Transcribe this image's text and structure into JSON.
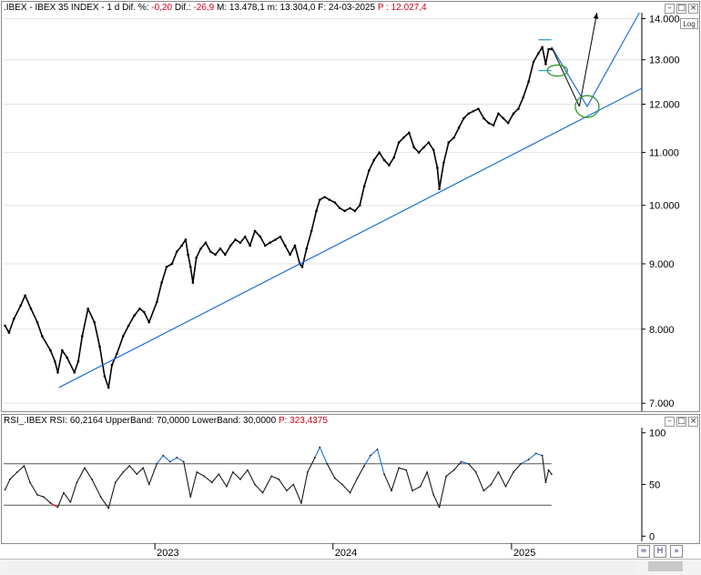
{
  "price_header": {
    "symbol": ".IBEX - IBEX 35 INDEX - 1 d",
    "dif_label": "Dif. %:",
    "dif_pct": "-0,20",
    "dif_abs_label": "Dif.:",
    "dif_abs": "-26,9",
    "max_label": "M:",
    "max": "13.478,1",
    "min_label": "m:",
    "min": "13.304,0",
    "date_label": "F:",
    "date": "24-03-2025",
    "p_label": "P :",
    "p_value": "12.027,4"
  },
  "rsi_header": {
    "name": "RSI_.IBEX",
    "rsi_label": "RSI:",
    "rsi_value": "60,2164",
    "upper_label": "UpperBand:",
    "upper_value": "70,0000",
    "lower_label": "LowerBand:",
    "lower_value": "30,0000",
    "p_label": "P:",
    "p_value": "323,4375"
  },
  "controls": {
    "log_label": "Log",
    "minimize_glyph": "–",
    "maximize_glyph": "□",
    "close_glyph": "×"
  },
  "colors": {
    "price": "#000000",
    "trendline": "#1f6fd6",
    "ellipse": "#2e9a2e",
    "rsi_line": "#1a1a1a",
    "rsi_over": "#1f6fd6",
    "rsi_under": "#d0021b",
    "band": "#555555",
    "grid": "#e3e3e3"
  },
  "chart_data": [
    {
      "type": "line",
      "title": "",
      "scale": "log",
      "ylim": [
        6900,
        14150
      ],
      "y_ticks": [
        {
          "value": 7000,
          "label": "7.000"
        },
        {
          "value": 8000,
          "label": "8.000"
        },
        {
          "value": 9000,
          "label": "9.000"
        },
        {
          "value": 10000,
          "label": "10.000"
        },
        {
          "value": 11000,
          "label": "11.000"
        },
        {
          "value": 12000,
          "label": "12.000"
        },
        {
          "value": 13000,
          "label": "13.000"
        },
        {
          "value": 14000,
          "label": "14.000"
        }
      ],
      "x_range": [
        "2022-02-25",
        "2025-09-25"
      ],
      "x_ticks": [
        {
          "date": "2023-01-01",
          "label": "2023"
        },
        {
          "date": "2024-01-01",
          "label": "2024"
        },
        {
          "date": "2025-01-01",
          "label": "2025"
        }
      ],
      "series": [
        {
          "key": "close",
          "points": [
            [
              "2022-02-28",
              8050
            ],
            [
              "2022-03-08",
              7950
            ],
            [
              "2022-03-18",
              8150
            ],
            [
              "2022-04-01",
              8350
            ],
            [
              "2022-04-10",
              8500
            ],
            [
              "2022-04-22",
              8300
            ],
            [
              "2022-05-05",
              8100
            ],
            [
              "2022-05-15",
              7900
            ],
            [
              "2022-06-01",
              7700
            ],
            [
              "2022-06-10",
              7550
            ],
            [
              "2022-06-16",
              7400
            ],
            [
              "2022-06-25",
              7700
            ],
            [
              "2022-07-05",
              7600
            ],
            [
              "2022-07-20",
              7400
            ],
            [
              "2022-07-28",
              7550
            ],
            [
              "2022-08-05",
              7900
            ],
            [
              "2022-08-17",
              8300
            ],
            [
              "2022-08-30",
              8100
            ],
            [
              "2022-09-10",
              7750
            ],
            [
              "2022-09-20",
              7350
            ],
            [
              "2022-09-28",
              7200
            ],
            [
              "2022-10-05",
              7500
            ],
            [
              "2022-10-15",
              7650
            ],
            [
              "2022-10-28",
              7900
            ],
            [
              "2022-11-08",
              8050
            ],
            [
              "2022-11-20",
              8200
            ],
            [
              "2022-12-01",
              8300
            ],
            [
              "2022-12-10",
              8250
            ],
            [
              "2022-12-20",
              8100
            ],
            [
              "2023-01-05",
              8400
            ],
            [
              "2023-01-15",
              8700
            ],
            [
              "2023-01-25",
              8950
            ],
            [
              "2023-02-05",
              9000
            ],
            [
              "2023-02-15",
              9200
            ],
            [
              "2023-02-25",
              9300
            ],
            [
              "2023-03-05",
              9400
            ],
            [
              "2023-03-10",
              9150
            ],
            [
              "2023-03-15",
              8950
            ],
            [
              "2023-03-20",
              8700
            ],
            [
              "2023-03-27",
              9100
            ],
            [
              "2023-04-05",
              9250
            ],
            [
              "2023-04-15",
              9350
            ],
            [
              "2023-04-25",
              9200
            ],
            [
              "2023-05-05",
              9150
            ],
            [
              "2023-05-15",
              9250
            ],
            [
              "2023-05-25",
              9150
            ],
            [
              "2023-06-05",
              9300
            ],
            [
              "2023-06-15",
              9400
            ],
            [
              "2023-06-25",
              9350
            ],
            [
              "2023-07-05",
              9450
            ],
            [
              "2023-07-15",
              9300
            ],
            [
              "2023-07-25",
              9550
            ],
            [
              "2023-08-05",
              9450
            ],
            [
              "2023-08-15",
              9300
            ],
            [
              "2023-08-25",
              9350
            ],
            [
              "2023-09-05",
              9400
            ],
            [
              "2023-09-15",
              9450
            ],
            [
              "2023-09-25",
              9300
            ],
            [
              "2023-10-05",
              9150
            ],
            [
              "2023-10-15",
              9300
            ],
            [
              "2023-10-25",
              9000
            ],
            [
              "2023-10-30",
              8950
            ],
            [
              "2023-11-08",
              9250
            ],
            [
              "2023-11-18",
              9550
            ],
            [
              "2023-11-28",
              9900
            ],
            [
              "2023-12-05",
              10100
            ],
            [
              "2023-12-15",
              10150
            ],
            [
              "2023-12-25",
              10100
            ],
            [
              "2024-01-05",
              10050
            ],
            [
              "2024-01-15",
              9950
            ],
            [
              "2024-01-25",
              9900
            ],
            [
              "2024-02-05",
              9950
            ],
            [
              "2024-02-15",
              9900
            ],
            [
              "2024-02-25",
              10000
            ],
            [
              "2024-03-05",
              10350
            ],
            [
              "2024-03-15",
              10650
            ],
            [
              "2024-03-25",
              10850
            ],
            [
              "2024-04-05",
              11000
            ],
            [
              "2024-04-15",
              10850
            ],
            [
              "2024-04-25",
              10750
            ],
            [
              "2024-05-05",
              10900
            ],
            [
              "2024-05-15",
              11200
            ],
            [
              "2024-05-25",
              11300
            ],
            [
              "2024-06-05",
              11400
            ],
            [
              "2024-06-15",
              11100
            ],
            [
              "2024-06-25",
              11000
            ],
            [
              "2024-07-05",
              11100
            ],
            [
              "2024-07-15",
              11200
            ],
            [
              "2024-07-25",
              11050
            ],
            [
              "2024-08-02",
              10700
            ],
            [
              "2024-08-06",
              10300
            ],
            [
              "2024-08-15",
              10800
            ],
            [
              "2024-08-25",
              11200
            ],
            [
              "2024-09-05",
              11300
            ],
            [
              "2024-09-15",
              11500
            ],
            [
              "2024-09-25",
              11700
            ],
            [
              "2024-10-05",
              11800
            ],
            [
              "2024-10-15",
              11850
            ],
            [
              "2024-10-25",
              11900
            ],
            [
              "2024-11-05",
              11700
            ],
            [
              "2024-11-15",
              11600
            ],
            [
              "2024-11-25",
              11550
            ],
            [
              "2024-12-05",
              11800
            ],
            [
              "2024-12-15",
              11700
            ],
            [
              "2024-12-25",
              11600
            ],
            [
              "2025-01-05",
              11800
            ],
            [
              "2025-01-15",
              11900
            ],
            [
              "2025-01-25",
              12150
            ],
            [
              "2025-02-05",
              12500
            ],
            [
              "2025-02-15",
              12950
            ],
            [
              "2025-02-25",
              13150
            ],
            [
              "2025-03-05",
              13300
            ],
            [
              "2025-03-12",
              12900
            ],
            [
              "2025-03-18",
              13250
            ],
            [
              "2025-03-24",
              13250
            ]
          ]
        }
      ],
      "trendline": {
        "from": [
          "2022-06-18",
          7200
        ],
        "to": [
          "2025-09-25",
          12350
        ]
      },
      "range_markers": [
        {
          "date_from": "2025-02-25",
          "date_to": "2025-03-24",
          "value": 13478
        },
        {
          "date_from": "2025-02-25",
          "date_to": "2025-03-24",
          "value": 12750
        }
      ],
      "projection_path": [
        [
          "2025-03-24",
          13300
        ],
        [
          "2025-06-05",
          11950
        ],
        [
          "2025-09-20",
          14150
        ]
      ],
      "arrow": {
        "from": [
          "2025-05-20",
          11950
        ],
        "to": [
          "2025-06-25",
          14150
        ]
      },
      "ellipses": [
        {
          "date": "2025-04-05",
          "value": 12750
        },
        {
          "date": "2025-06-05",
          "value": 11950
        }
      ]
    },
    {
      "type": "line",
      "title": "",
      "ylim": [
        -5,
        105
      ],
      "y_ticks": [
        {
          "value": 0,
          "label": "0"
        },
        {
          "value": 50,
          "label": "50"
        },
        {
          "value": 100,
          "label": "100"
        }
      ],
      "bands": [
        70,
        30
      ],
      "series": [
        {
          "key": "rsi",
          "points": [
            [
              "2022-02-28",
              45
            ],
            [
              "2022-03-10",
              55
            ],
            [
              "2022-03-25",
              62
            ],
            [
              "2022-04-08",
              68
            ],
            [
              "2022-04-20",
              52
            ],
            [
              "2022-05-05",
              40
            ],
            [
              "2022-05-18",
              38
            ],
            [
              "2022-06-01",
              32
            ],
            [
              "2022-06-16",
              28
            ],
            [
              "2022-06-28",
              42
            ],
            [
              "2022-07-12",
              33
            ],
            [
              "2022-07-25",
              52
            ],
            [
              "2022-08-10",
              66
            ],
            [
              "2022-08-25",
              55
            ],
            [
              "2022-09-12",
              38
            ],
            [
              "2022-09-28",
              27
            ],
            [
              "2022-10-12",
              52
            ],
            [
              "2022-10-28",
              62
            ],
            [
              "2022-11-10",
              68
            ],
            [
              "2022-11-25",
              60
            ],
            [
              "2022-12-08",
              66
            ],
            [
              "2022-12-20",
              50
            ],
            [
              "2023-01-05",
              70
            ],
            [
              "2023-01-18",
              78
            ],
            [
              "2023-02-01",
              72
            ],
            [
              "2023-02-15",
              76
            ],
            [
              "2023-03-01",
              72
            ],
            [
              "2023-03-15",
              38
            ],
            [
              "2023-03-28",
              62
            ],
            [
              "2023-04-12",
              58
            ],
            [
              "2023-04-28",
              52
            ],
            [
              "2023-05-12",
              60
            ],
            [
              "2023-05-28",
              48
            ],
            [
              "2023-06-10",
              62
            ],
            [
              "2023-06-25",
              55
            ],
            [
              "2023-07-10",
              64
            ],
            [
              "2023-07-25",
              50
            ],
            [
              "2023-08-10",
              42
            ],
            [
              "2023-08-28",
              58
            ],
            [
              "2023-09-12",
              55
            ],
            [
              "2023-09-28",
              44
            ],
            [
              "2023-10-12",
              50
            ],
            [
              "2023-10-28",
              32
            ],
            [
              "2023-11-10",
              62
            ],
            [
              "2023-11-25",
              76
            ],
            [
              "2023-12-05",
              86
            ],
            [
              "2023-12-20",
              70
            ],
            [
              "2024-01-05",
              56
            ],
            [
              "2024-01-20",
              50
            ],
            [
              "2024-02-05",
              42
            ],
            [
              "2024-02-20",
              56
            ],
            [
              "2024-03-05",
              68
            ],
            [
              "2024-03-18",
              78
            ],
            [
              "2024-04-01",
              84
            ],
            [
              "2024-04-15",
              60
            ],
            [
              "2024-04-30",
              44
            ],
            [
              "2024-05-15",
              66
            ],
            [
              "2024-05-30",
              64
            ],
            [
              "2024-06-12",
              44
            ],
            [
              "2024-06-28",
              48
            ],
            [
              "2024-07-12",
              62
            ],
            [
              "2024-07-25",
              40
            ],
            [
              "2024-08-06",
              28
            ],
            [
              "2024-08-20",
              58
            ],
            [
              "2024-09-05",
              64
            ],
            [
              "2024-09-20",
              72
            ],
            [
              "2024-10-05",
              70
            ],
            [
              "2024-10-20",
              62
            ],
            [
              "2024-11-05",
              44
            ],
            [
              "2024-11-20",
              50
            ],
            [
              "2024-12-05",
              62
            ],
            [
              "2024-12-20",
              48
            ],
            [
              "2025-01-05",
              62
            ],
            [
              "2025-01-20",
              70
            ],
            [
              "2025-02-05",
              74
            ],
            [
              "2025-02-20",
              80
            ],
            [
              "2025-03-05",
              78
            ],
            [
              "2025-03-12",
              52
            ],
            [
              "2025-03-18",
              64
            ],
            [
              "2025-03-24",
              60
            ]
          ]
        }
      ]
    }
  ]
}
